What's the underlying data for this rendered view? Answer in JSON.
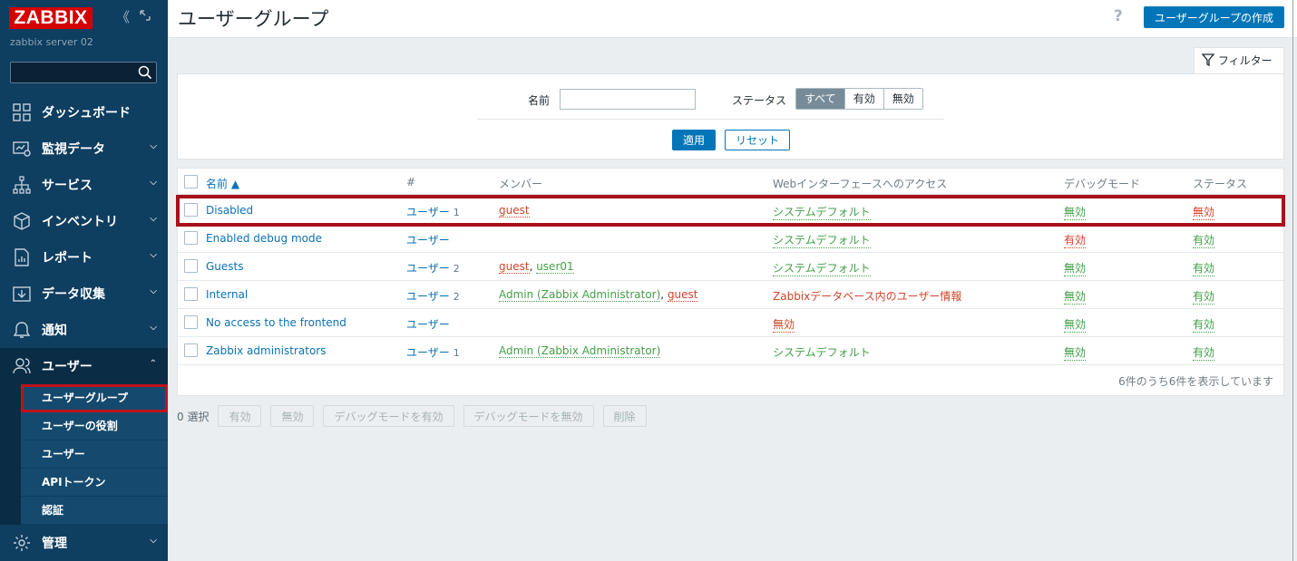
{
  "sidebar": {
    "logo": "ZABBIX",
    "server_name": "zabbix server 02",
    "search_placeholder": "",
    "menu": [
      {
        "label": "ダッシュボード",
        "icon": "dashboard-icon",
        "has_chevron": false
      },
      {
        "label": "監視データ",
        "icon": "monitoring-icon",
        "has_chevron": true
      },
      {
        "label": "サービス",
        "icon": "services-icon",
        "has_chevron": true
      },
      {
        "label": "インベントリ",
        "icon": "inventory-icon",
        "has_chevron": true
      },
      {
        "label": "レポート",
        "icon": "reports-icon",
        "has_chevron": true
      },
      {
        "label": "データ収集",
        "icon": "data-collection-icon",
        "has_chevron": true
      },
      {
        "label": "通知",
        "icon": "alerts-icon",
        "has_chevron": true
      },
      {
        "label": "ユーザー",
        "icon": "users-icon",
        "has_chevron": true
      },
      {
        "label": "管理",
        "icon": "gear-icon",
        "has_chevron": true
      }
    ],
    "users_submenu": [
      "ユーザーグループ",
      "ユーザーの役割",
      "ユーザー",
      "APIトークン",
      "認証"
    ]
  },
  "header": {
    "title": "ユーザーグループ",
    "help": "?",
    "create_button": "ユーザーグループの作成"
  },
  "filter": {
    "tab_label": "フィルター",
    "name_label": "名前",
    "name_value": "",
    "status_label": "ステータス",
    "status_options": [
      "すべて",
      "有効",
      "無効"
    ],
    "status_selected": "すべて",
    "apply": "適用",
    "reset": "リセット"
  },
  "table": {
    "headers": {
      "name": "名前 ▲",
      "count": "#",
      "members": "メンバー",
      "gui_access": "Webインターフェースへのアクセス",
      "debug": "デバッグモード",
      "status": "ステータス"
    },
    "rows": [
      {
        "name": "Disabled",
        "users_label": "ユーザー",
        "users_count": "1",
        "members": [
          {
            "text": "guest",
            "color": "red"
          }
        ],
        "gui_access": "システムデフォルト",
        "gui_color": "green",
        "gui_dotted": true,
        "debug": "無効",
        "debug_color": "green",
        "status": "無効",
        "status_color": "red"
      },
      {
        "name": "Enabled debug mode",
        "users_label": "ユーザー",
        "users_count": "",
        "members": [],
        "gui_access": "システムデフォルト",
        "gui_color": "green",
        "gui_dotted": true,
        "debug": "有効",
        "debug_color": "red",
        "status": "有効",
        "status_color": "green"
      },
      {
        "name": "Guests",
        "users_label": "ユーザー",
        "users_count": "2",
        "members": [
          {
            "text": "guest",
            "color": "red"
          },
          {
            "text": "user01",
            "color": "green"
          }
        ],
        "gui_access": "システムデフォルト",
        "gui_color": "green",
        "gui_dotted": true,
        "debug": "無効",
        "debug_color": "green",
        "status": "有効",
        "status_color": "green"
      },
      {
        "name": "Internal",
        "users_label": "ユーザー",
        "users_count": "2",
        "members": [
          {
            "text": "Admin (Zabbix Administrator)",
            "color": "green"
          },
          {
            "text": "guest",
            "color": "red"
          }
        ],
        "gui_access": "Zabbixデータベース内のユーザー情報",
        "gui_color": "red",
        "gui_dotted": false,
        "debug": "無効",
        "debug_color": "green",
        "status": "有効",
        "status_color": "green"
      },
      {
        "name": "No access to the frontend",
        "users_label": "ユーザー",
        "users_count": "",
        "members": [],
        "gui_access": "無効",
        "gui_color": "red",
        "gui_dotted": true,
        "debug": "無効",
        "debug_color": "green",
        "status": "有効",
        "status_color": "green"
      },
      {
        "name": "Zabbix administrators",
        "users_label": "ユーザー",
        "users_count": "1",
        "members": [
          {
            "text": "Admin (Zabbix Administrator)",
            "color": "green"
          }
        ],
        "gui_access": "システムデフォルト",
        "gui_color": "green",
        "gui_dotted": false,
        "debug": "無効",
        "debug_color": "green",
        "status": "有効",
        "status_color": "green"
      }
    ],
    "footer": "6件のうち6件を表示しています"
  },
  "actions": {
    "selected": "0 選択",
    "buttons": [
      "有効",
      "無効",
      "デバッグモードを有効",
      "デバッグモードを無効",
      "削除"
    ]
  },
  "colors": {
    "sidebar_bg": "#0e3e60",
    "accent": "#0275b8",
    "logo_red": "#d40000",
    "highlight": "#a8101b",
    "red": "#d1442a",
    "green": "#429e47"
  }
}
